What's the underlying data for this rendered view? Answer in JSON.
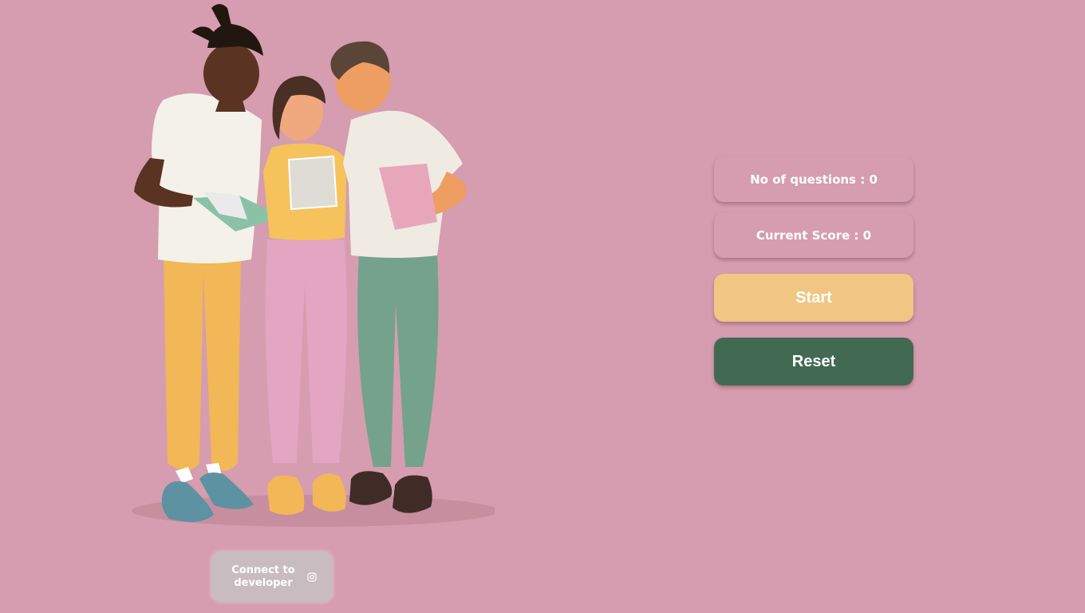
{
  "stats": {
    "questions_label": "No of questions : ",
    "questions_value": "0",
    "score_label": "Current Score : ",
    "score_value": "0"
  },
  "actions": {
    "start_label": "Start",
    "reset_label": "Reset"
  },
  "footer": {
    "connect_label": "Connect to developer",
    "icon": "instagram-icon"
  },
  "colors": {
    "background": "#d59daf",
    "start": "#f0c682",
    "reset": "#426a53",
    "connect": "#c9bcc1"
  }
}
